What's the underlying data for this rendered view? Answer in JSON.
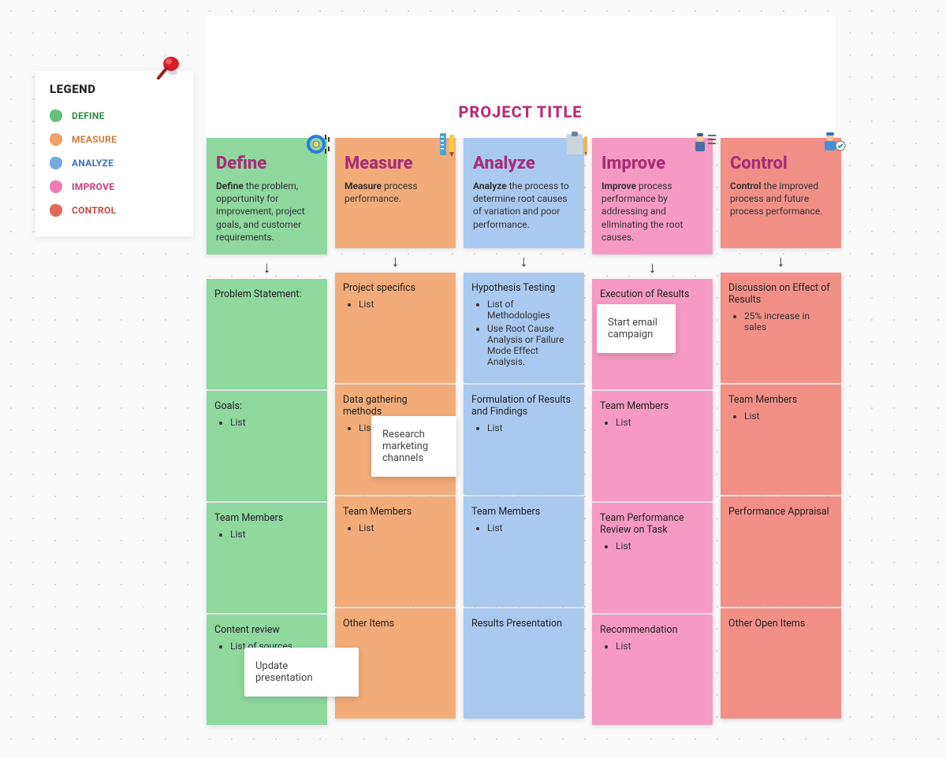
{
  "title": "PROJECT TITLE",
  "legend": {
    "heading": "LEGEND",
    "items": [
      {
        "label": "DEFINE"
      },
      {
        "label": "MEASURE"
      },
      {
        "label": "ANALYZE"
      },
      {
        "label": "IMPROVE"
      },
      {
        "label": "CONTROL"
      }
    ]
  },
  "columns": {
    "define": {
      "title": "Define",
      "desc_bold": "Define",
      "desc_rest": " the problem, opportunity for improvement, project goals, and customer requirements.",
      "cells": [
        {
          "title": "Problem Statement:",
          "items": []
        },
        {
          "title": "Goals:",
          "items": [
            "List"
          ]
        },
        {
          "title": "Team Members",
          "items": [
            "List"
          ]
        },
        {
          "title": "Content review",
          "items": [
            "List of sources"
          ],
          "sticky": "Update presentation"
        }
      ]
    },
    "measure": {
      "title": "Measure",
      "desc_bold": "Measure",
      "desc_rest": " process performance.",
      "cells": [
        {
          "title": "Project specifics",
          "items": [
            "List"
          ]
        },
        {
          "title": "Data gathering methods",
          "items": [
            "List"
          ],
          "sticky": "Research marketing channels"
        },
        {
          "title": "Team Members",
          "items": [
            "List"
          ]
        },
        {
          "title": "Other Items",
          "items": []
        }
      ]
    },
    "analyze": {
      "title": "Analyze",
      "desc_bold": "Analyze",
      "desc_rest": " the process to determine root causes of variation and poor performance.",
      "cells": [
        {
          "title": "Hypothesis Testing",
          "items": [
            "List of Methodologies",
            "Use Root Cause Analysis or Failure Mode Effect Analysis."
          ]
        },
        {
          "title": "Formulation of Results and Findings",
          "items": [
            "List"
          ]
        },
        {
          "title": "Team Members",
          "items": [
            "List"
          ]
        },
        {
          "title": "Results Presentation",
          "items": []
        }
      ]
    },
    "improve": {
      "title": "Improve",
      "desc_bold": "Improve",
      "desc_rest": " process performance by addressing and eliminating the root causes.",
      "cells": [
        {
          "title": "Execution of Results",
          "items": [],
          "sticky": "Start email campaign"
        },
        {
          "title": "Team Members",
          "items": [
            "List"
          ]
        },
        {
          "title": "Team Performance Review on Task",
          "items": [
            "List"
          ]
        },
        {
          "title": "Recommendation",
          "items": [
            "List"
          ]
        }
      ]
    },
    "control": {
      "title": "Control",
      "desc_bold": "Control",
      "desc_rest": " the improved process and future process performance.",
      "cells": [
        {
          "title": "Discussion on Effect of Results",
          "items": [
            "25% increase in sales"
          ]
        },
        {
          "title": "Team Members",
          "items": [
            "List"
          ]
        },
        {
          "title": "Performance Appraisal",
          "items": []
        },
        {
          "title": "Other Open Items",
          "items": []
        }
      ]
    }
  }
}
